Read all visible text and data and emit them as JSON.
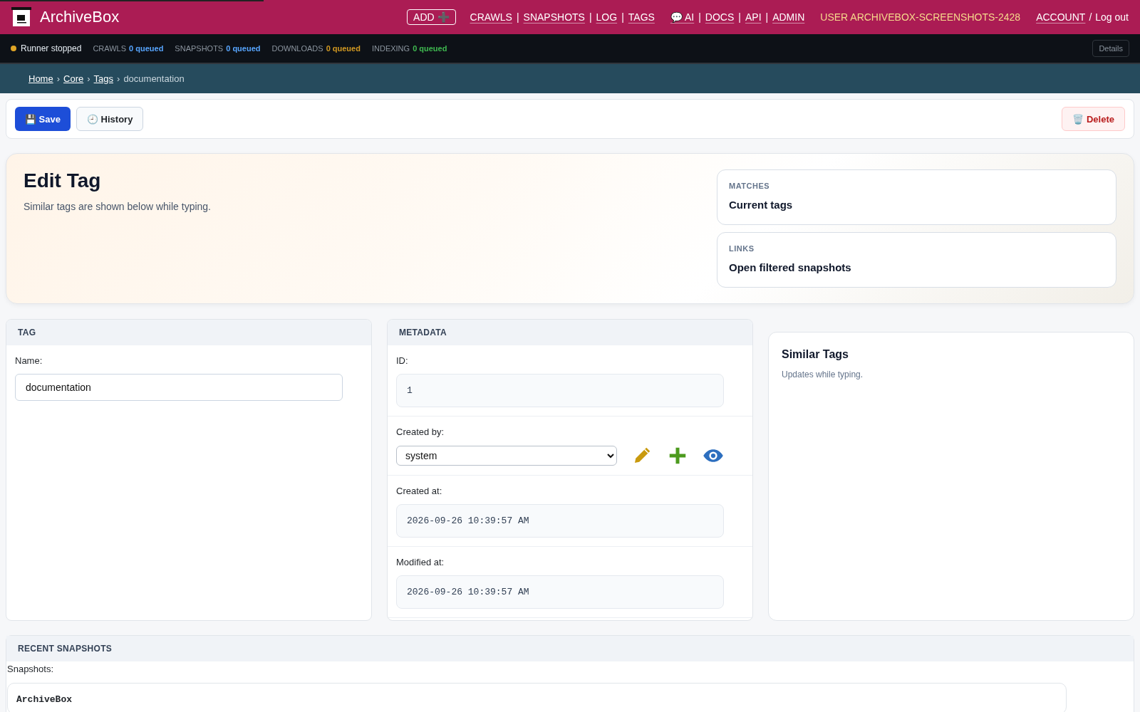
{
  "header": {
    "title": "ArchiveBox",
    "add_button": "ADD ➕",
    "nav_groups": [
      {
        "links": [
          "CRAWLS",
          "SNAPSHOTS",
          "LOG",
          "TAGS"
        ]
      },
      {
        "links": [
          "💬 AI",
          "DOCS",
          "API",
          "ADMIN"
        ]
      }
    ],
    "separator": "|",
    "user": "USER ARCHIVEBOX-SCREENSHOTS-2428",
    "account": "ACCOUNT",
    "account_separator": "/",
    "logout": "Log out"
  },
  "status_bar": {
    "runner": {
      "label": "Runner stopped",
      "color": "#e0a526"
    },
    "queues": [
      {
        "label": "CRAWLS",
        "value": "0 queued",
        "color": "#58a6ff"
      },
      {
        "label": "SNAPSHOTS",
        "value": "0 queued",
        "color": "#58a6ff"
      },
      {
        "label": "DOWNLOADS",
        "value": "0 queued",
        "color": "#d29922"
      },
      {
        "label": "INDEXING",
        "value": "0 queued",
        "color": "#3fb950"
      }
    ],
    "details_button": "Details"
  },
  "breadcrumb": {
    "links": [
      "Home",
      "Core",
      "Tags"
    ],
    "separator": "›",
    "current": "documentation"
  },
  "toolbar": {
    "save": "💾 Save",
    "history": "🕘 History",
    "delete": "🗑️ Delete"
  },
  "hero": {
    "title": "Edit Tag",
    "subtitle": "Similar tags are shown below while typing.",
    "cards": [
      {
        "label": "MATCHES",
        "link": "Current tags"
      },
      {
        "label": "LINKS",
        "link": "Open filtered snapshots"
      }
    ]
  },
  "tag_panel": {
    "heading": "TAG",
    "name_label": "Name:",
    "name_value": "documentation"
  },
  "metadata_panel": {
    "heading": "METADATA",
    "rows": [
      {
        "kind": "readonly",
        "label": "ID:",
        "value": "1"
      },
      {
        "kind": "select",
        "label": "Created by:",
        "value": "system"
      },
      {
        "kind": "readonly",
        "label": "Created at:",
        "value": "2026-09-26 10:39:57 AM"
      },
      {
        "kind": "readonly",
        "label": "Modified at:",
        "value": "2026-09-26 10:39:57 AM"
      }
    ]
  },
  "similar_panel": {
    "title": "Similar Tags",
    "subtitle": "Updates while typing."
  },
  "recent_snapshots": {
    "heading": "RECENT SNAPSHOTS",
    "label": "Snapshots:",
    "snapshots": [
      {
        "title": "ArchiveBox"
      }
    ]
  }
}
